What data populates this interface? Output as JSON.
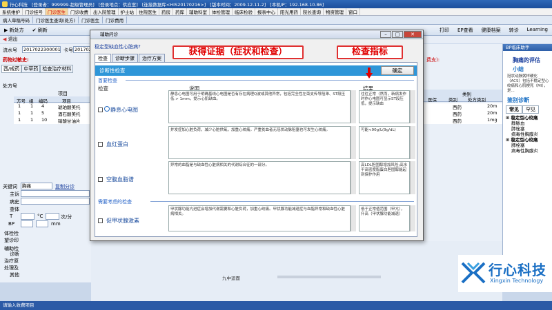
{
  "window": {
    "app_icon": "app-icon",
    "title_parts": [
      "行心科技",
      "[登录者：999999-超级管理员]",
      "[登录地点：供应室]",
      "[连接数据库<HIS20170216>]",
      "[版本时间：2009.12.11.2]",
      "[本机IP：192.168.10.86]"
    ]
  },
  "menubar": {
    "items": [
      "系统维护",
      "门诊挂号",
      "门诊医生",
      "门诊收费",
      "出入院管理",
      "护士站",
      "住院医生",
      "药房",
      "药库",
      "辅助科室",
      "体检管理",
      "临床检验",
      "报表中心",
      "阳光用药",
      "院长查询",
      "物资管理",
      "窗口"
    ],
    "highlighted": "门诊医生"
  },
  "tabs": {
    "items": [
      "病人草稿号码",
      "门诊医生查询(处方)",
      "门诊医生",
      "门诊费用"
    ]
  },
  "toolbar": {
    "left": [
      "新处方",
      "刷新"
    ],
    "right": [
      "打印",
      "EP查看",
      "健康档案",
      "转诊",
      "Learning"
    ]
  },
  "exit_label": "退出",
  "left_panel": {
    "serial_label": "流水号",
    "serial_value": "2017022300001",
    "card_label": "卡号",
    "card_value": "2017022",
    "allergy_label": "药物过敏史:",
    "sub_tabs": [
      "西/成药",
      "中草药",
      "检查治疗材料"
    ],
    "rx_label": "处方号",
    "item_label": "项目",
    "grid_headers": [
      "方号",
      "组",
      "编码",
      "项目"
    ],
    "grid_rows": [
      {
        "no": "1",
        "group": "1",
        "code": "4",
        "item": "琥珀酸美托"
      },
      {
        "no": "1",
        "group": "1",
        "code": "5",
        "item": "酒石酸美托"
      },
      {
        "no": "1",
        "group": "1",
        "code": "10",
        "item": "硝酸甘油片"
      }
    ],
    "form_labels": [
      "关键词",
      "主诉",
      "病史",
      "查体",
      "T",
      "BP",
      "体检检",
      "望诊印",
      "辅助检",
      "诊断",
      "治疗原",
      "处理及",
      "其他"
    ],
    "keyword_value": "胸痛",
    "keyword_link": "复制分诊",
    "units": [
      "mm",
      "°C",
      "次/分"
    ],
    "scroll_label": "九中运面"
  },
  "mid_grid": {
    "category_header": "类别",
    "right_headers": [
      "医保",
      "类别",
      "处方类别"
    ],
    "right_rows": [
      {
        "category": "西药",
        "rx": "20m"
      },
      {
        "category": "西药",
        "rx": "20m"
      },
      {
        "category": "西药",
        "rx": "1mg"
      }
    ],
    "fee_label": "费支):"
  },
  "right_panel": {
    "header": "BP临床助手",
    "title": "胸痛的评估",
    "summary_title": "小结",
    "summary_text": "冠状动脉粥样硬化（ACS）包括不稳定型心绞痛和心肌梗死（MI），是...",
    "diff_title": "鉴别诊断",
    "tab_common": "常见",
    "tab_rare": "罕见",
    "items": [
      "稳定型心绞痛",
      "静脉血",
      "肺栓塞",
      "病毒性胸膜炎",
      "稳定型心绞痛",
      "肺栓塞",
      "病毒性胸膜炎"
    ]
  },
  "dialog": {
    "title": "辅助问诊",
    "subtitle": "稳定型缺血性心脏病?",
    "tabs": [
      "检查",
      "诊断步骤",
      "治疗方案"
    ],
    "active_tab": "检查",
    "head_title": "诊断性检查",
    "ok_label": "确定",
    "section1_title": "首要检查",
    "section2_title": "需要考虑的检查",
    "col_check": "检查",
    "col_desc": "说明",
    "col_result": "结果",
    "rows": [
      {
        "name": "静息心电图",
        "desc": "静息心电图可用于明确基线心电图是否有存在病理Q波或其他异常，包括完全性左束支传导阻滞、ST段压低 > 1mm，提示心肌缺血。",
        "result": "往往正常（然而，新病发作时作心电图可显示ST段压低，提示缺血"
      },
      {
        "name": "血红蛋白",
        "desc": "并发症加心脏负荷，减少心脏供氧，加重心绞痛。严重贫血者无冠状动脉阻塞也可发生心绞痛。",
        "result": "可能<90g/L(9g/dL)"
      },
      {
        "name": "空腹血脂谱",
        "desc": "异常的血脂是与缺血性心脏病相关的代谢综合征的一部分。",
        "result": "高LDL胆固醇增加风险;高水平高密度脂蛋白胆固醇能起到保护作用"
      },
      {
        "name": "促甲状腺激素",
        "desc": "甲状腺功能亢进症会增加代谢需要和心脏负荷，加重心绞痛。甲状腺功能减退症与血脂异常和缺血性心脏病相关。",
        "result": "低于正常值范围（甲亢），升高（甲状腺功能减退）"
      }
    ]
  },
  "annotations": {
    "evidence": "获得证据（症状和检查）",
    "indicator": "检查指标"
  },
  "statusbar": {
    "text": "请输入收费项目"
  },
  "logo": {
    "name_cn": "行心科技",
    "name_en": "Xingxin Technology"
  },
  "colors": {
    "dialog_header": "#2e96d8",
    "annotation_red": "#e00000",
    "title_blue": "#1b4f9c",
    "link_blue": "#2050a0"
  }
}
